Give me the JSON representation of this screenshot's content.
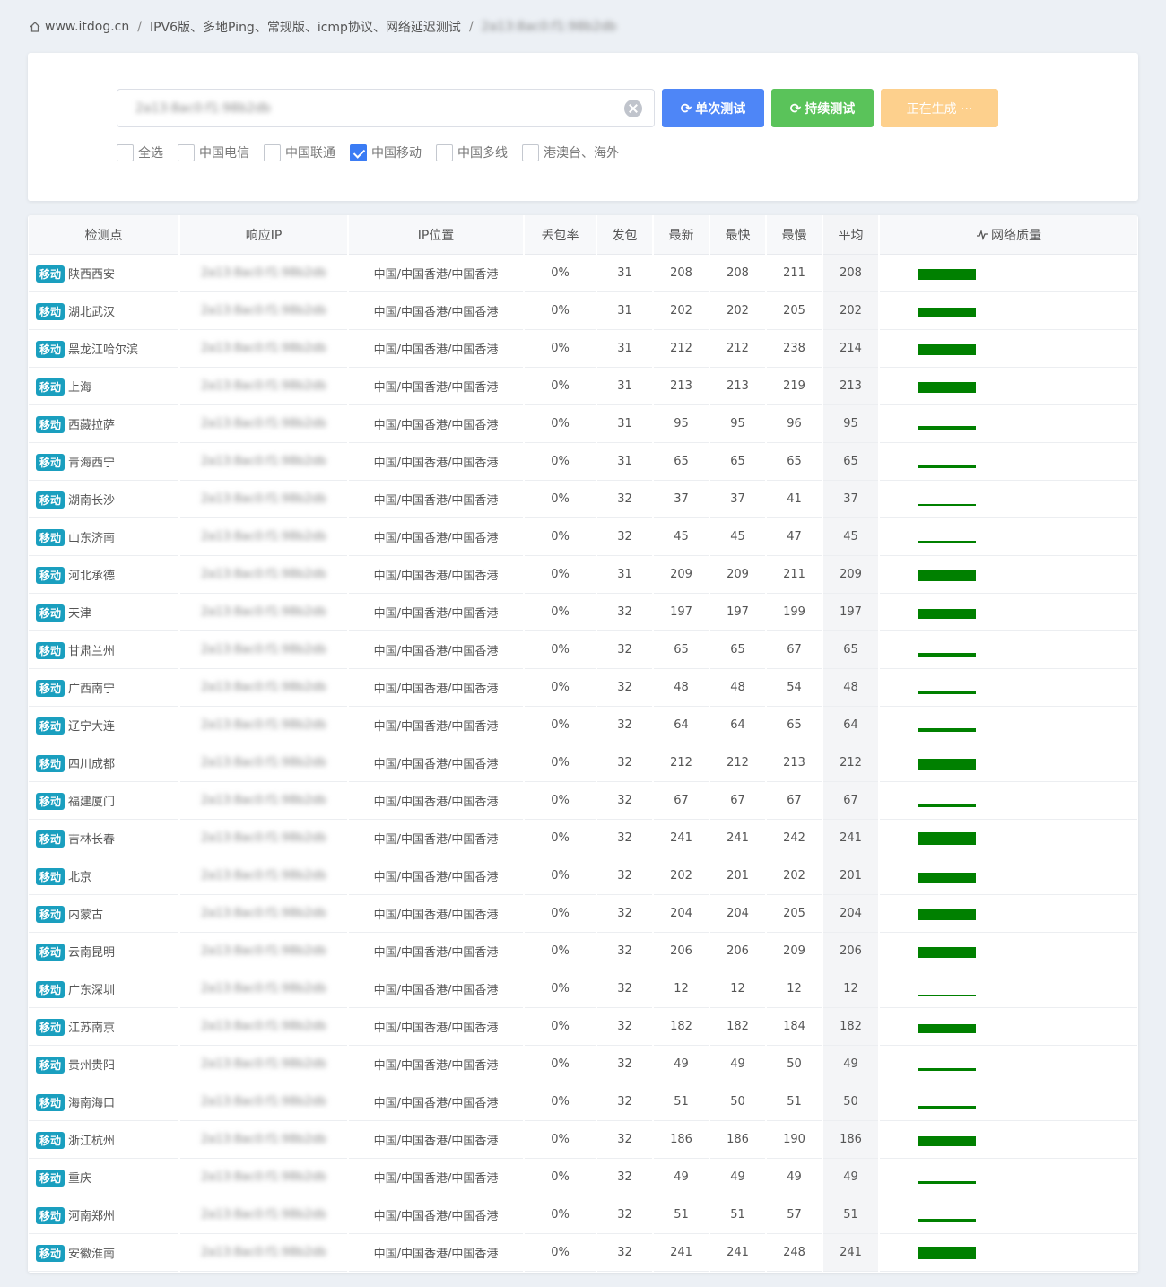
{
  "breadcrumb": {
    "site": "www.itdog.cn",
    "page": "IPV6版、多地Ping、常规版、icmp协议、网络延迟测试",
    "target": "2a13:8ac0:f1:98b2db"
  },
  "search": {
    "value": "2a13:8ac0:f1:98b2db",
    "single_label": "单次测试",
    "continuous_label": "持续测试",
    "generating_label": "正在生成 ···"
  },
  "filters": [
    {
      "label": "全选",
      "checked": false
    },
    {
      "label": "中国电信",
      "checked": false
    },
    {
      "label": "中国联通",
      "checked": false
    },
    {
      "label": "中国移动",
      "checked": true
    },
    {
      "label": "中国多线",
      "checked": false
    },
    {
      "label": "港澳台、海外",
      "checked": false
    }
  ],
  "table": {
    "headers": [
      "检测点",
      "响应IP",
      "IP位置",
      "丢包率",
      "发包",
      "最新",
      "最快",
      "最慢",
      "平均",
      "网络质量"
    ],
    "isp_tag": "移动",
    "bar_color": "#008000",
    "rows": [
      {
        "node": "陕西西安",
        "ip": "2a13:8ac0:f1:98b2db",
        "loc": "中国/中国香港/中国香港",
        "loss": "0%",
        "sent": "31",
        "latest": "208",
        "fast": "208",
        "slow": "211",
        "avg": "208",
        "quality": 0.84
      },
      {
        "node": "湖北武汉",
        "ip": "2a13:8ac0:f1:98b2db",
        "loc": "中国/中国香港/中国香港",
        "loss": "0%",
        "sent": "31",
        "latest": "202",
        "fast": "202",
        "slow": "205",
        "avg": "202",
        "quality": 0.82
      },
      {
        "node": "黑龙江哈尔滨",
        "ip": "2a13:8ac0:f1:98b2db",
        "loc": "中国/中国香港/中国香港",
        "loss": "0%",
        "sent": "31",
        "latest": "212",
        "fast": "212",
        "slow": "238",
        "avg": "214",
        "quality": 0.86
      },
      {
        "node": "上海",
        "ip": "2a13:8ac0:f1:98b2db",
        "loc": "中国/中国香港/中国香港",
        "loss": "0%",
        "sent": "31",
        "latest": "213",
        "fast": "213",
        "slow": "219",
        "avg": "213",
        "quality": 0.86
      },
      {
        "node": "西藏拉萨",
        "ip": "2a13:8ac0:f1:98b2db",
        "loc": "中国/中国香港/中国香港",
        "loss": "0%",
        "sent": "31",
        "latest": "95",
        "fast": "95",
        "slow": "96",
        "avg": "95",
        "quality": 0.38
      },
      {
        "node": "青海西宁",
        "ip": "2a13:8ac0:f1:98b2db",
        "loc": "中国/中国香港/中国香港",
        "loss": "0%",
        "sent": "31",
        "latest": "65",
        "fast": "65",
        "slow": "65",
        "avg": "65",
        "quality": 0.26
      },
      {
        "node": "湖南长沙",
        "ip": "2a13:8ac0:f1:98b2db",
        "loc": "中国/中国香港/中国香港",
        "loss": "0%",
        "sent": "32",
        "latest": "37",
        "fast": "37",
        "slow": "41",
        "avg": "37",
        "quality": 0.15
      },
      {
        "node": "山东济南",
        "ip": "2a13:8ac0:f1:98b2db",
        "loc": "中国/中国香港/中国香港",
        "loss": "0%",
        "sent": "32",
        "latest": "45",
        "fast": "45",
        "slow": "47",
        "avg": "45",
        "quality": 0.18
      },
      {
        "node": "河北承德",
        "ip": "2a13:8ac0:f1:98b2db",
        "loc": "中国/中国香港/中国香港",
        "loss": "0%",
        "sent": "31",
        "latest": "209",
        "fast": "209",
        "slow": "211",
        "avg": "209",
        "quality": 0.84
      },
      {
        "node": "天津",
        "ip": "2a13:8ac0:f1:98b2db",
        "loc": "中国/中国香港/中国香港",
        "loss": "0%",
        "sent": "32",
        "latest": "197",
        "fast": "197",
        "slow": "199",
        "avg": "197",
        "quality": 0.8
      },
      {
        "node": "甘肃兰州",
        "ip": "2a13:8ac0:f1:98b2db",
        "loc": "中国/中国香港/中国香港",
        "loss": "0%",
        "sent": "32",
        "latest": "65",
        "fast": "65",
        "slow": "67",
        "avg": "65",
        "quality": 0.26
      },
      {
        "node": "广西南宁",
        "ip": "2a13:8ac0:f1:98b2db",
        "loc": "中国/中国香港/中国香港",
        "loss": "0%",
        "sent": "32",
        "latest": "48",
        "fast": "48",
        "slow": "54",
        "avg": "48",
        "quality": 0.19
      },
      {
        "node": "辽宁大连",
        "ip": "2a13:8ac0:f1:98b2db",
        "loc": "中国/中国香港/中国香港",
        "loss": "0%",
        "sent": "32",
        "latest": "64",
        "fast": "64",
        "slow": "65",
        "avg": "64",
        "quality": 0.26
      },
      {
        "node": "四川成都",
        "ip": "2a13:8ac0:f1:98b2db",
        "loc": "中国/中国香港/中国香港",
        "loss": "0%",
        "sent": "32",
        "latest": "212",
        "fast": "212",
        "slow": "213",
        "avg": "212",
        "quality": 0.86
      },
      {
        "node": "福建厦门",
        "ip": "2a13:8ac0:f1:98b2db",
        "loc": "中国/中国香港/中国香港",
        "loss": "0%",
        "sent": "32",
        "latest": "67",
        "fast": "67",
        "slow": "67",
        "avg": "67",
        "quality": 0.27
      },
      {
        "node": "吉林长春",
        "ip": "2a13:8ac0:f1:98b2db",
        "loc": "中国/中国香港/中国香港",
        "loss": "0%",
        "sent": "32",
        "latest": "241",
        "fast": "241",
        "slow": "242",
        "avg": "241",
        "quality": 0.98
      },
      {
        "node": "北京",
        "ip": "2a13:8ac0:f1:98b2db",
        "loc": "中国/中国香港/中国香港",
        "loss": "0%",
        "sent": "32",
        "latest": "202",
        "fast": "201",
        "slow": "202",
        "avg": "201",
        "quality": 0.82
      },
      {
        "node": "内蒙古",
        "ip": "2a13:8ac0:f1:98b2db",
        "loc": "中国/中国香港/中国香港",
        "loss": "0%",
        "sent": "32",
        "latest": "204",
        "fast": "204",
        "slow": "205",
        "avg": "204",
        "quality": 0.83
      },
      {
        "node": "云南昆明",
        "ip": "2a13:8ac0:f1:98b2db",
        "loc": "中国/中国香港/中国香港",
        "loss": "0%",
        "sent": "32",
        "latest": "206",
        "fast": "206",
        "slow": "209",
        "avg": "206",
        "quality": 0.84
      },
      {
        "node": "广东深圳",
        "ip": "2a13:8ac0:f1:98b2db",
        "loc": "中国/中国香港/中国香港",
        "loss": "0%",
        "sent": "32",
        "latest": "12",
        "fast": "12",
        "slow": "12",
        "avg": "12",
        "quality": 0.05
      },
      {
        "node": "江苏南京",
        "ip": "2a13:8ac0:f1:98b2db",
        "loc": "中国/中国香港/中国香港",
        "loss": "0%",
        "sent": "32",
        "latest": "182",
        "fast": "182",
        "slow": "184",
        "avg": "182",
        "quality": 0.74
      },
      {
        "node": "贵州贵阳",
        "ip": "2a13:8ac0:f1:98b2db",
        "loc": "中国/中国香港/中国香港",
        "loss": "0%",
        "sent": "32",
        "latest": "49",
        "fast": "49",
        "slow": "50",
        "avg": "49",
        "quality": 0.2
      },
      {
        "node": "海南海口",
        "ip": "2a13:8ac0:f1:98b2db",
        "loc": "中国/中国香港/中国香港",
        "loss": "0%",
        "sent": "32",
        "latest": "51",
        "fast": "50",
        "slow": "51",
        "avg": "50",
        "quality": 0.2
      },
      {
        "node": "浙江杭州",
        "ip": "2a13:8ac0:f1:98b2db",
        "loc": "中国/中国香港/中国香港",
        "loss": "0%",
        "sent": "32",
        "latest": "186",
        "fast": "186",
        "slow": "190",
        "avg": "186",
        "quality": 0.76
      },
      {
        "node": "重庆",
        "ip": "2a13:8ac0:f1:98b2db",
        "loc": "中国/中国香港/中国香港",
        "loss": "0%",
        "sent": "32",
        "latest": "49",
        "fast": "49",
        "slow": "49",
        "avg": "49",
        "quality": 0.2
      },
      {
        "node": "河南郑州",
        "ip": "2a13:8ac0:f1:98b2db",
        "loc": "中国/中国香港/中国香港",
        "loss": "0%",
        "sent": "32",
        "latest": "51",
        "fast": "51",
        "slow": "57",
        "avg": "51",
        "quality": 0.21
      },
      {
        "node": "安徽淮南",
        "ip": "2a13:8ac0:f1:98b2db",
        "loc": "中国/中国香港/中国香港",
        "loss": "0%",
        "sent": "32",
        "latest": "241",
        "fast": "241",
        "slow": "248",
        "avg": "241",
        "quality": 0.98
      }
    ]
  }
}
